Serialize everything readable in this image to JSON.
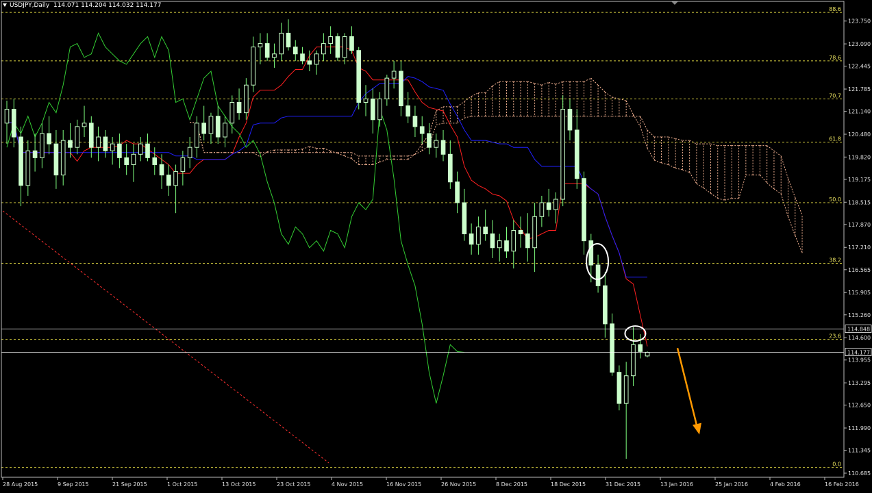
{
  "header": {
    "symbol": "USDJPY,Daily",
    "ohlc": "114.071 114.204 114.032 114.177"
  },
  "colors": {
    "background": "#000000",
    "candle_body": "#ccffcc",
    "wick": "#7fff7f",
    "tenkan": "#ff2020",
    "kijun": "#2020ff",
    "chikou": "#33cc33",
    "cloud": "#f0b090",
    "fib": "#d8d040",
    "price_line": "#ffffff",
    "arrow": "#ff9900",
    "diagonal": "#ff3030"
  },
  "chart_data": {
    "type": "candlestick",
    "instrument": "USDJPY",
    "timeframe": "Daily",
    "ylim": [
      110.685,
      124.2
    ],
    "y_ticks": [
      "123.750",
      "123.090",
      "122.445",
      "121.785",
      "121.140",
      "120.480",
      "119.820",
      "119.175",
      "118.515",
      "117.870",
      "117.210",
      "116.565",
      "115.905",
      "115.260",
      "114.600",
      "113.955",
      "113.295",
      "112.650",
      "111.990",
      "111.345",
      "110.685"
    ],
    "x_ticks": [
      "28 Aug 2015",
      "9 Sep 2015",
      "21 Sep 2015",
      "1 Oct 2015",
      "13 Oct 2015",
      "23 Oct 2015",
      "4 Nov 2015",
      "16 Nov 2015",
      "26 Nov 2015",
      "8 Dec 2015",
      "18 Dec 2015",
      "31 Dec 2015",
      "13 Jan 2016",
      "25 Jan 2016",
      "4 Feb 2016",
      "16 Feb 2016"
    ],
    "fib_levels": [
      {
        "label": "88.6",
        "price": 124.0
      },
      {
        "label": "78.6",
        "price": 122.6
      },
      {
        "label": "70.7",
        "price": 121.5
      },
      {
        "label": "61.8",
        "price": 120.25
      },
      {
        "label": "50.0",
        "price": 118.5
      },
      {
        "label": "38.2",
        "price": 116.75
      },
      {
        "label": "23.6",
        "price": 114.55
      },
      {
        "label": "0.0",
        "price": 110.85
      }
    ],
    "price_labels": [
      {
        "label": "114.848",
        "price": 114.848
      },
      {
        "label": "114.177",
        "price": 114.177
      }
    ],
    "ohlc": [
      [
        120.8,
        121.45,
        120.2,
        121.2
      ],
      [
        121.2,
        121.5,
        120.1,
        120.4
      ],
      [
        120.4,
        120.7,
        118.4,
        119.0
      ],
      [
        119.0,
        120.3,
        118.7,
        120.0
      ],
      [
        120.0,
        120.5,
        119.4,
        119.8
      ],
      [
        119.8,
        120.8,
        119.5,
        120.5
      ],
      [
        120.5,
        121.0,
        119.9,
        120.2
      ],
      [
        120.2,
        120.6,
        118.9,
        119.3
      ],
      [
        119.3,
        120.6,
        119.0,
        120.3
      ],
      [
        120.3,
        120.8,
        119.8,
        120.1
      ],
      [
        120.1,
        120.9,
        119.9,
        120.7
      ],
      [
        120.7,
        121.3,
        120.4,
        120.8
      ],
      [
        120.8,
        121.0,
        119.8,
        120.1
      ],
      [
        120.1,
        120.7,
        119.7,
        120.4
      ],
      [
        120.4,
        120.6,
        119.8,
        120.0
      ],
      [
        120.0,
        120.4,
        119.6,
        120.2
      ],
      [
        120.2,
        120.5,
        119.5,
        119.8
      ],
      [
        119.8,
        120.2,
        119.3,
        119.6
      ],
      [
        119.6,
        120.2,
        119.1,
        119.9
      ],
      [
        119.9,
        120.4,
        119.7,
        120.2
      ],
      [
        120.2,
        120.5,
        119.7,
        119.8
      ],
      [
        119.8,
        120.1,
        119.3,
        119.6
      ],
      [
        119.6,
        119.9,
        118.9,
        119.3
      ],
      [
        119.3,
        119.6,
        118.7,
        119.0
      ],
      [
        119.0,
        119.6,
        118.2,
        119.4
      ],
      [
        119.4,
        120.0,
        119.0,
        119.8
      ],
      [
        119.8,
        120.4,
        119.5,
        120.1
      ],
      [
        120.1,
        121.0,
        119.8,
        120.8
      ],
      [
        120.8,
        121.3,
        120.3,
        120.5
      ],
      [
        120.5,
        121.1,
        120.2,
        121.0
      ],
      [
        121.0,
        121.3,
        120.2,
        120.4
      ],
      [
        120.4,
        121.0,
        120.1,
        120.8
      ],
      [
        120.8,
        121.6,
        120.5,
        121.4
      ],
      [
        121.4,
        121.8,
        120.9,
        121.1
      ],
      [
        121.1,
        122.1,
        120.9,
        121.9
      ],
      [
        121.9,
        123.3,
        121.7,
        123.0
      ],
      [
        123.0,
        123.4,
        122.5,
        123.1
      ],
      [
        123.1,
        123.4,
        122.6,
        122.7
      ],
      [
        122.7,
        123.1,
        122.4,
        122.8
      ],
      [
        122.8,
        123.7,
        122.6,
        123.4
      ],
      [
        123.4,
        123.8,
        122.9,
        123.0
      ],
      [
        123.0,
        123.2,
        122.6,
        122.8
      ],
      [
        122.8,
        123.0,
        122.5,
        122.6
      ],
      [
        122.6,
        122.9,
        122.3,
        122.5
      ],
      [
        122.5,
        122.9,
        122.2,
        122.8
      ],
      [
        122.8,
        123.4,
        122.6,
        123.1
      ],
      [
        123.1,
        123.6,
        122.8,
        123.3
      ],
      [
        123.3,
        123.4,
        122.6,
        122.7
      ],
      [
        122.7,
        123.4,
        122.5,
        123.3
      ],
      [
        123.3,
        123.6,
        122.8,
        122.9
      ],
      [
        122.9,
        123.0,
        121.2,
        121.4
      ],
      [
        121.4,
        121.9,
        121.0,
        121.5
      ],
      [
        121.5,
        121.8,
        120.5,
        120.9
      ],
      [
        120.9,
        121.7,
        120.7,
        121.5
      ],
      [
        121.5,
        122.2,
        121.3,
        122.1
      ],
      [
        122.1,
        122.6,
        121.8,
        122.3
      ],
      [
        122.3,
        122.6,
        121.0,
        121.3
      ],
      [
        121.3,
        121.7,
        120.8,
        121.0
      ],
      [
        121.0,
        121.3,
        120.4,
        120.7
      ],
      [
        120.7,
        121.0,
        120.2,
        120.5
      ],
      [
        120.5,
        120.8,
        119.9,
        120.1
      ],
      [
        120.1,
        120.5,
        119.8,
        120.3
      ],
      [
        120.3,
        120.6,
        119.7,
        119.9
      ],
      [
        119.9,
        120.3,
        118.9,
        119.1
      ],
      [
        119.1,
        119.4,
        118.2,
        118.5
      ],
      [
        118.5,
        118.9,
        117.4,
        117.6
      ],
      [
        117.6,
        117.9,
        117.0,
        117.3
      ],
      [
        117.3,
        118.1,
        117.0,
        117.8
      ],
      [
        117.8,
        118.3,
        117.4,
        117.6
      ],
      [
        117.6,
        118.0,
        116.9,
        117.2
      ],
      [
        117.2,
        117.6,
        116.8,
        117.4
      ],
      [
        117.4,
        117.8,
        116.9,
        117.1
      ],
      [
        117.1,
        118.0,
        116.6,
        117.7
      ],
      [
        117.7,
        118.1,
        117.2,
        117.6
      ],
      [
        117.6,
        118.2,
        116.8,
        117.2
      ],
      [
        117.2,
        118.5,
        116.5,
        118.1
      ],
      [
        118.1,
        118.7,
        117.8,
        118.5
      ],
      [
        118.5,
        118.9,
        118.1,
        118.3
      ],
      [
        118.3,
        118.8,
        117.9,
        118.6
      ],
      [
        118.6,
        121.6,
        118.4,
        121.2
      ],
      [
        121.2,
        121.5,
        120.3,
        120.6
      ],
      [
        120.6,
        121.2,
        118.9,
        119.2
      ],
      [
        119.2,
        119.4,
        117.0,
        117.4
      ],
      [
        117.4,
        117.6,
        116.2,
        116.7
      ],
      [
        116.7,
        117.0,
        115.9,
        116.1
      ],
      [
        116.1,
        116.5,
        114.6,
        115.0
      ],
      [
        115.0,
        115.3,
        113.5,
        113.6
      ],
      [
        113.6,
        113.8,
        112.5,
        112.7
      ],
      [
        112.7,
        113.9,
        111.1,
        113.5
      ],
      [
        113.5,
        114.9,
        113.2,
        114.4
      ],
      [
        114.4,
        114.7,
        114.0,
        114.2
      ],
      [
        114.071,
        114.204,
        114.032,
        114.177
      ]
    ],
    "series": [
      {
        "name": "Tenkan-sen",
        "values": []
      },
      {
        "name": "Kijun-sen",
        "values": []
      },
      {
        "name": "Chikou Span",
        "values": []
      }
    ]
  }
}
